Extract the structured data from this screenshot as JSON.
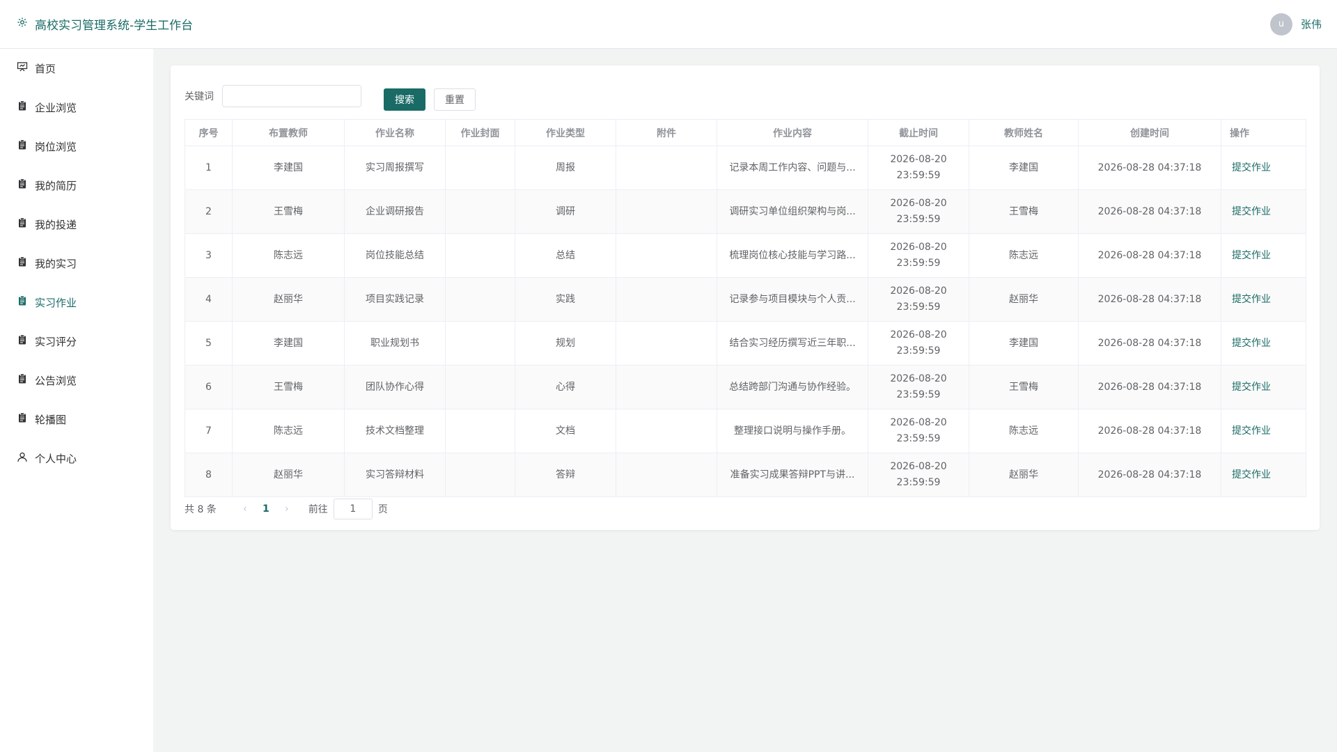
{
  "header": {
    "title": "高校实习管理系统-学生工作台",
    "title_icon": "gear-icon",
    "avatar_letter": "u",
    "username": "张伟"
  },
  "sidebar": {
    "active_color": "#1a6b66",
    "items": [
      {
        "label": "首页",
        "icon": "presentation-icon"
      },
      {
        "label": "企业浏览",
        "icon": "clipboard-icon"
      },
      {
        "label": "岗位浏览",
        "icon": "clipboard-icon"
      },
      {
        "label": "我的简历",
        "icon": "clipboard-icon"
      },
      {
        "label": "我的投递",
        "icon": "clipboard-icon"
      },
      {
        "label": "我的实习",
        "icon": "clipboard-icon"
      },
      {
        "label": "实习作业",
        "icon": "clipboard-icon",
        "active": true
      },
      {
        "label": "实习评分",
        "icon": "clipboard-icon"
      },
      {
        "label": "公告浏览",
        "icon": "clipboard-icon"
      },
      {
        "label": "轮播图",
        "icon": "clipboard-icon"
      },
      {
        "label": "个人中心",
        "icon": "user-icon"
      }
    ]
  },
  "search": {
    "label": "关键词",
    "value": "",
    "placeholder": "",
    "search_button": "搜索",
    "reset_button": "重置"
  },
  "table": {
    "columns": [
      "序号",
      "布置教师",
      "作业名称",
      "作业封面",
      "作业类型",
      "附件",
      "作业内容",
      "截止时间",
      "教师姓名",
      "创建时间",
      "操作"
    ],
    "action_label": "提交作业",
    "rows": [
      {
        "index": "1",
        "teacher": "李建国",
        "name": "实习周报撰写",
        "cover": "",
        "type": "周报",
        "attachment": "",
        "content": "记录本周工作内容、问题与...",
        "deadline_date": "2026-08-20",
        "deadline_time": "23:59:59",
        "teacher_name": "李建国",
        "created": "2026-08-28 04:37:18"
      },
      {
        "index": "2",
        "teacher": "王雪梅",
        "name": "企业调研报告",
        "cover": "",
        "type": "调研",
        "attachment": "",
        "content": "调研实习单位组织架构与岗...",
        "deadline_date": "2026-08-20",
        "deadline_time": "23:59:59",
        "teacher_name": "王雪梅",
        "created": "2026-08-28 04:37:18"
      },
      {
        "index": "3",
        "teacher": "陈志远",
        "name": "岗位技能总结",
        "cover": "",
        "type": "总结",
        "attachment": "",
        "content": "梳理岗位核心技能与学习路...",
        "deadline_date": "2026-08-20",
        "deadline_time": "23:59:59",
        "teacher_name": "陈志远",
        "created": "2026-08-28 04:37:18"
      },
      {
        "index": "4",
        "teacher": "赵丽华",
        "name": "项目实践记录",
        "cover": "",
        "type": "实践",
        "attachment": "",
        "content": "记录参与项目模块与个人贡...",
        "deadline_date": "2026-08-20",
        "deadline_time": "23:59:59",
        "teacher_name": "赵丽华",
        "created": "2026-08-28 04:37:18"
      },
      {
        "index": "5",
        "teacher": "李建国",
        "name": "职业规划书",
        "cover": "",
        "type": "规划",
        "attachment": "",
        "content": "结合实习经历撰写近三年职...",
        "deadline_date": "2026-08-20",
        "deadline_time": "23:59:59",
        "teacher_name": "李建国",
        "created": "2026-08-28 04:37:18"
      },
      {
        "index": "6",
        "teacher": "王雪梅",
        "name": "团队协作心得",
        "cover": "",
        "type": "心得",
        "attachment": "",
        "content": "总结跨部门沟通与协作经验。",
        "deadline_date": "2026-08-20",
        "deadline_time": "23:59:59",
        "teacher_name": "王雪梅",
        "created": "2026-08-28 04:37:18"
      },
      {
        "index": "7",
        "teacher": "陈志远",
        "name": "技术文档整理",
        "cover": "",
        "type": "文档",
        "attachment": "",
        "content": "整理接口说明与操作手册。",
        "deadline_date": "2026-08-20",
        "deadline_time": "23:59:59",
        "teacher_name": "陈志远",
        "created": "2026-08-28 04:37:18"
      },
      {
        "index": "8",
        "teacher": "赵丽华",
        "name": "实习答辩材料",
        "cover": "",
        "type": "答辩",
        "attachment": "",
        "content": "准备实习成果答辩PPT与讲...",
        "deadline_date": "2026-08-20",
        "deadline_time": "23:59:59",
        "teacher_name": "赵丽华",
        "created": "2026-08-28 04:37:18"
      }
    ]
  },
  "pagination": {
    "total": "共 8 条",
    "prev_icon": "chevron-left-icon",
    "current_page": "1",
    "next_icon": "chevron-right-icon",
    "goto_label": "前往",
    "goto_value": "1",
    "page_suffix": "页"
  }
}
